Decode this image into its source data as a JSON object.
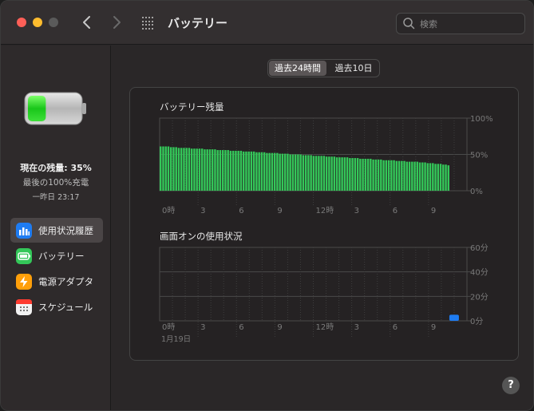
{
  "window": {
    "title": "バッテリー"
  },
  "search": {
    "placeholder": "検索"
  },
  "sidebar": {
    "status_main": "現在の残量: 35%",
    "status_sub": "最後の100%充電",
    "status_time": "一昨日 23:17",
    "battery_level": 0.35,
    "items": [
      {
        "label": "使用状況履歴",
        "icon": "bar-chart-icon",
        "color": "#1e7cf2",
        "active": true
      },
      {
        "label": "バッテリー",
        "icon": "battery-icon",
        "color": "#34c759",
        "active": false
      },
      {
        "label": "電源アダプタ",
        "icon": "bolt-icon",
        "color": "#ff9f0a",
        "active": false
      },
      {
        "label": "スケジュール",
        "icon": "calendar-icon",
        "color": "#ffffff",
        "active": false
      }
    ]
  },
  "segments": [
    {
      "label": "過去24時間",
      "selected": true
    },
    {
      "label": "過去10日",
      "selected": false
    }
  ],
  "chart_data": [
    {
      "type": "bar",
      "title": "バッテリー残量",
      "x_ticks": [
        "0時",
        "3",
        "6",
        "9",
        "12時",
        "3",
        "6",
        "9"
      ],
      "y_ticks": [
        "100%",
        "50%",
        "0%"
      ],
      "ylim": [
        0,
        100
      ],
      "bar_color": "#34c759",
      "values": [
        61,
        61,
        61,
        61,
        60,
        60,
        60,
        59,
        59,
        59,
        59,
        59,
        58,
        58,
        58,
        58,
        58,
        57,
        57,
        57,
        57,
        57,
        56,
        56,
        56,
        56,
        56,
        55,
        55,
        55,
        55,
        55,
        54,
        54,
        54,
        54,
        54,
        53,
        53,
        53,
        53,
        52,
        52,
        52,
        52,
        52,
        51,
        51,
        51,
        51,
        50,
        50,
        50,
        50,
        50,
        49,
        49,
        49,
        49,
        48,
        48,
        48,
        48,
        48,
        47,
        47,
        47,
        47,
        46,
        46,
        46,
        46,
        46,
        45,
        45,
        45,
        45,
        44,
        44,
        44,
        44,
        44,
        43,
        43,
        43,
        43,
        42,
        42,
        42,
        42,
        42,
        41,
        41,
        41,
        41,
        40,
        40,
        40,
        40,
        40,
        39,
        39,
        39,
        38,
        38,
        38,
        37,
        37,
        37,
        36,
        36,
        35
      ]
    },
    {
      "type": "bar",
      "title": "画面オンの使用状況",
      "x_ticks": [
        "0時",
        "3",
        "6",
        "9",
        "12時",
        "3",
        "6",
        "9"
      ],
      "x_sublabel": "1月19日",
      "y_ticks": [
        "60分",
        "40分",
        "20分",
        "0分"
      ],
      "ylim": [
        0,
        60
      ],
      "bar_color": "#1e7cf2",
      "bars": [
        {
          "hour": 23,
          "value": 5
        }
      ]
    }
  ],
  "help": {
    "label": "?"
  }
}
